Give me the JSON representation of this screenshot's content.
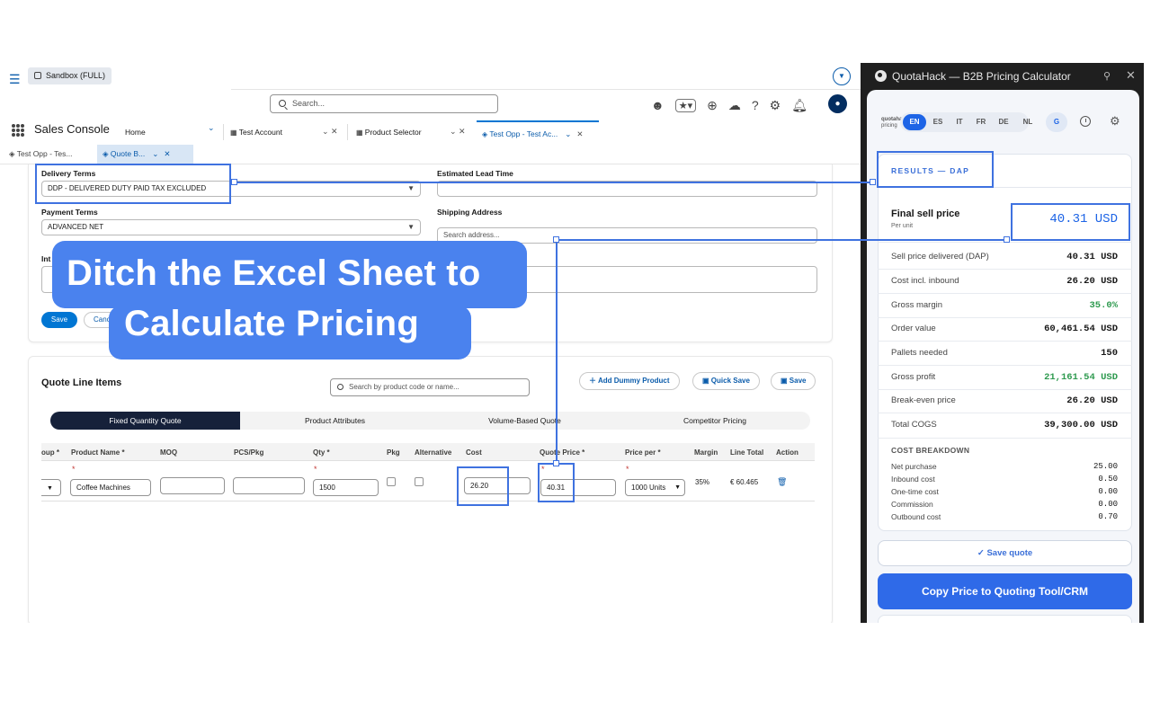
{
  "crm": {
    "sandbox_label": "Sandbox (FULL)",
    "search_placeholder": "Search...",
    "app_name": "Sales Console",
    "nav_tabs": [
      {
        "label": "Home"
      },
      {
        "label": "Test Account"
      },
      {
        "label": "Product Selector"
      },
      {
        "label": "Test Opp - Test Ac..."
      }
    ],
    "sub_tabs": [
      {
        "label": "Test Opp - Tes..."
      },
      {
        "label": "Quote B..."
      }
    ],
    "form": {
      "delivery_terms_label": "Delivery Terms",
      "delivery_terms_value": "DDP - DELIVERED DUTY PAID TAX EXCLUDED",
      "lead_time_label": "Estimated Lead Time",
      "payment_terms_label": "Payment Terms",
      "payment_terms_value": "ADVANCED NET",
      "shipping_label": "Shipping Address",
      "shipping_placeholder": "Search address...",
      "internal_label_fragment": "Int",
      "save_label": "Save",
      "cancel_label_fragment": "Canc"
    },
    "quote": {
      "title": "Quote Line Items",
      "search_placeholder": "Search by product code or name...",
      "add_dummy_label": "Add Dummy Product",
      "quick_save_label": "Quick Save",
      "save_label": "Save",
      "segments": [
        "Fixed Quantity Quote",
        "Product Attributes",
        "Volume-Based Quote",
        "Competitor Pricing"
      ],
      "columns": [
        "oup *",
        "Product Name *",
        "MOQ",
        "PCS/Pkg",
        "Qty *",
        "Pkg",
        "Alternative",
        "Cost",
        "Quote Price *",
        "Price per *",
        "Margin",
        "Line Total",
        "Action"
      ],
      "row": {
        "product_name": "Coffee Machines",
        "moq": "",
        "pcs_pkg": "",
        "qty": "1500",
        "cost": "26.20",
        "quote_price": "40.31",
        "price_per": "1000 Units",
        "margin": "35%",
        "line_total": "€ 60.465"
      }
    }
  },
  "headline": {
    "line1": "Ditch the Excel Sheet to",
    "line2": "Calculate Pricing"
  },
  "panel": {
    "title": "QuotaHack — B2B Pricing Calculator",
    "brand_line1": "quotahack",
    "brand_line2": "pricing",
    "languages": [
      "EN",
      "ES",
      "IT",
      "FR",
      "DE",
      "NL"
    ],
    "active_language": "EN",
    "g_label": "G",
    "results_title": "RESULTS — DAP",
    "final_sell_label": "Final sell price",
    "final_sell_unit": "Per unit",
    "final_sell_value": "40.31 USD",
    "metrics": [
      {
        "label": "Sell price delivered (DAP)",
        "value": "40.31 USD"
      },
      {
        "label": "Cost incl. inbound",
        "value": "26.20 USD"
      },
      {
        "label": "Gross margin",
        "value": "35.0%"
      },
      {
        "label": "Order value",
        "value": "60,461.54 USD"
      },
      {
        "label": "Pallets needed",
        "value": "150"
      },
      {
        "label": "Gross profit",
        "value": "21,161.54 USD"
      },
      {
        "label": "Break-even price",
        "value": "26.20 USD"
      },
      {
        "label": "Total COGS",
        "value": "39,300.00 USD"
      }
    ],
    "cost_breakdown_title": "COST BREAKDOWN",
    "cost_breakdown": [
      {
        "label": "Net purchase",
        "value": "25.00"
      },
      {
        "label": "Inbound cost",
        "value": "0.50"
      },
      {
        "label": "One-time cost",
        "value": "0.00"
      },
      {
        "label": "Commission",
        "value": "0.00"
      },
      {
        "label": "Outbound cost",
        "value": "0.70"
      }
    ],
    "save_quote_label": "Save quote",
    "copy_price_label": "Copy Price to Quoting Tool/CRM"
  },
  "colors": {
    "accent": "#3f72e0",
    "headline_bg": "#4a82ee",
    "crm_blue": "#0176d3",
    "margin_green": "#2e9a4f"
  }
}
